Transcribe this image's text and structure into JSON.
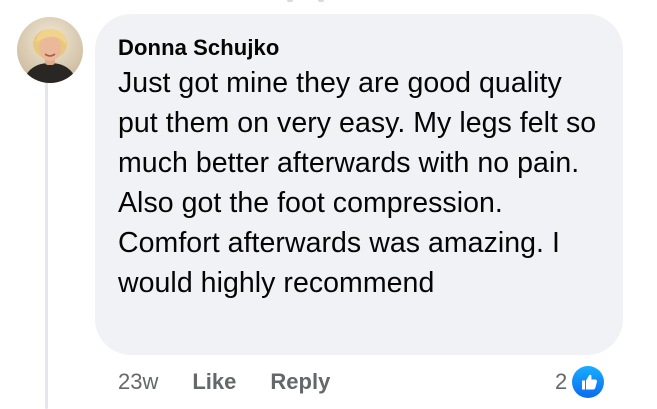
{
  "comment": {
    "author": "Donna Schujko",
    "text": "Just got mine they are good quality put them on very easy. My legs felt so much better afterwards with no pain. Also got the foot compression. Comfort afterwards was amazing. I would highly recommend",
    "avatar_icon": "profile-photo"
  },
  "actions": {
    "timestamp": "23w",
    "like_label": "Like",
    "reply_label": "Reply"
  },
  "reactions": {
    "count": "2",
    "icon": "thumbs-up-icon",
    "color": "#1877f2"
  },
  "colors": {
    "bubble": "#f0f2f5",
    "secondary_text": "#65676b",
    "thread_line": "#e4e6eb"
  }
}
